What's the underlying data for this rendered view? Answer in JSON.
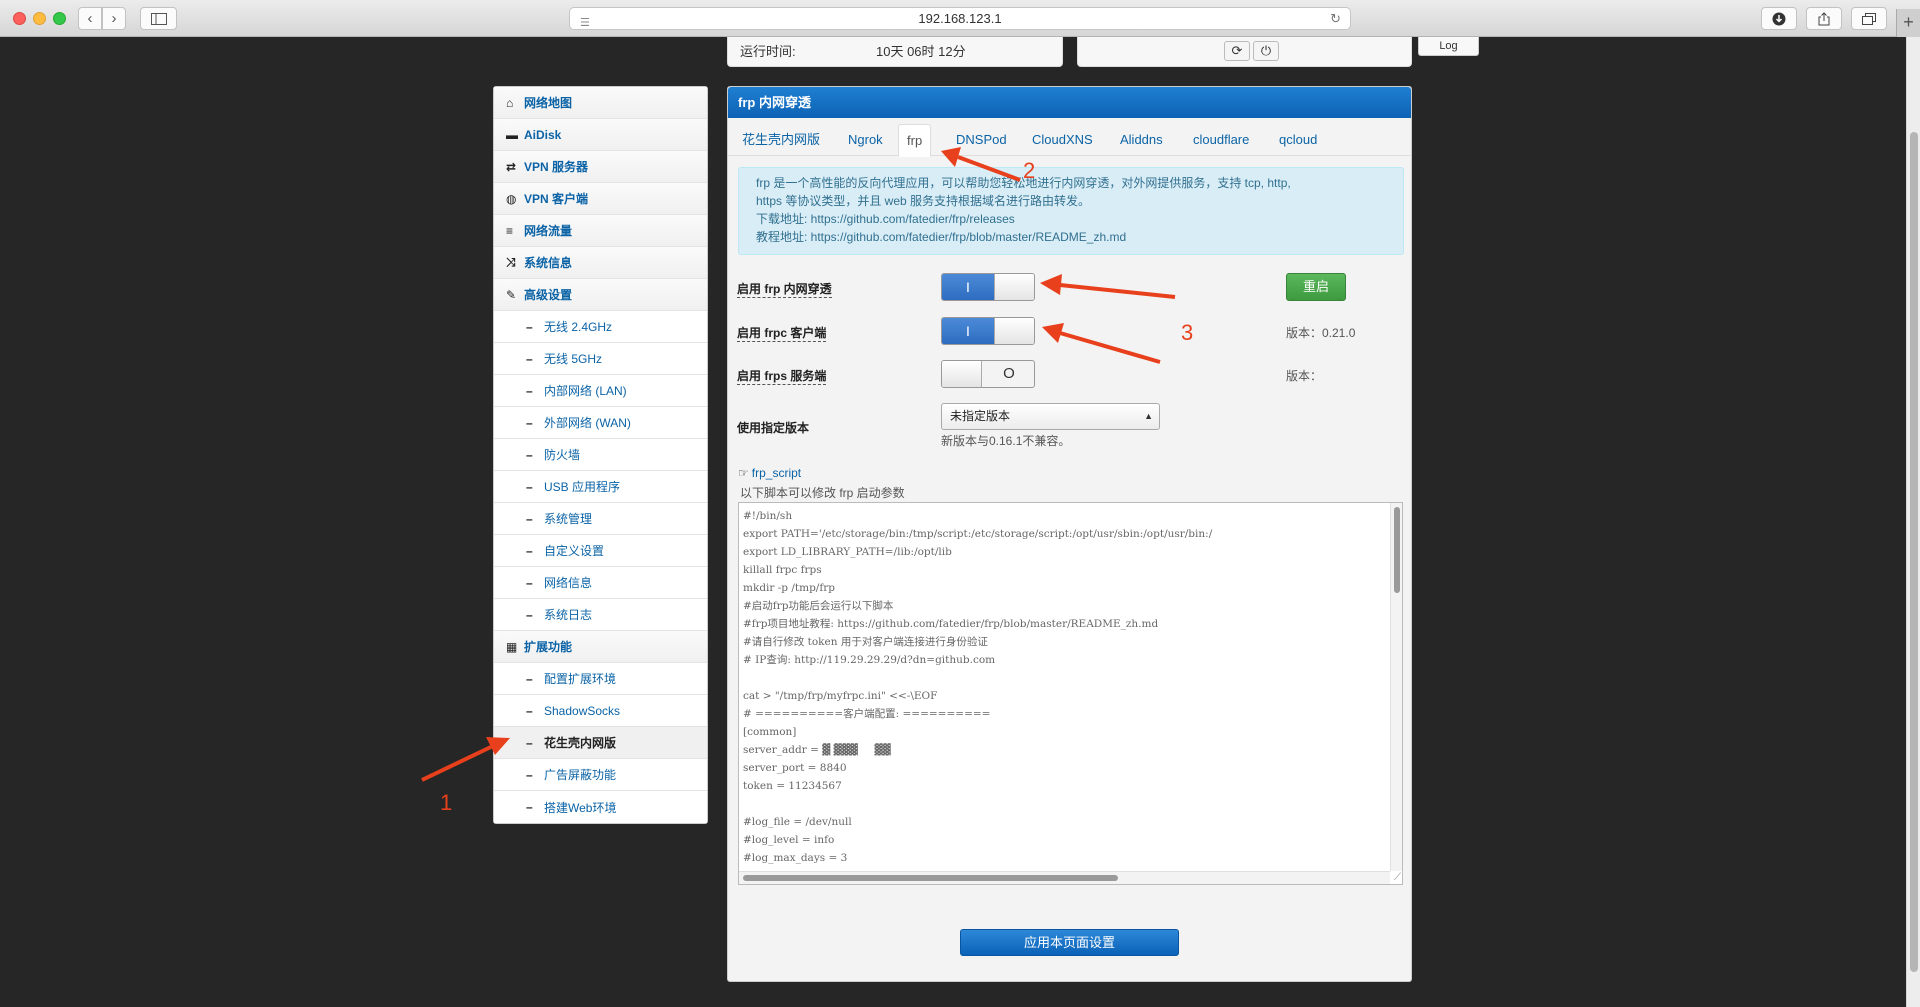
{
  "browser": {
    "url": "192.168.123.1",
    "nav_back_icon": "chevron-left-icon",
    "nav_forward_icon": "chevron-right-icon"
  },
  "status": {
    "uptime_label": "运行时间:",
    "uptime_value": "10天 06时 12分",
    "log_label": "Log"
  },
  "sidebar": {
    "items": [
      {
        "label": "网络地图",
        "icon": "home-icon",
        "level": "top"
      },
      {
        "label": "AiDisk",
        "icon": "drive-icon",
        "level": "top"
      },
      {
        "label": "VPN 服务器",
        "icon": "retweet-icon",
        "level": "top"
      },
      {
        "label": "VPN 客户端",
        "icon": "globe-icon",
        "level": "top"
      },
      {
        "label": "网络流量",
        "icon": "list-icon",
        "level": "top"
      },
      {
        "label": "系统信息",
        "icon": "random-icon",
        "level": "top"
      },
      {
        "label": "高级设置",
        "icon": "wrench-icon",
        "level": "top"
      },
      {
        "label": "无线 2.4GHz",
        "level": "sub"
      },
      {
        "label": "无线 5GHz",
        "level": "sub"
      },
      {
        "label": "内部网络 (LAN)",
        "level": "sub"
      },
      {
        "label": "外部网络 (WAN)",
        "level": "sub"
      },
      {
        "label": "防火墙",
        "level": "sub"
      },
      {
        "label": "USB 应用程序",
        "level": "sub"
      },
      {
        "label": "系统管理",
        "level": "sub"
      },
      {
        "label": "自定义设置",
        "level": "sub"
      },
      {
        "label": "网络信息",
        "level": "sub"
      },
      {
        "label": "系统日志",
        "level": "sub"
      },
      {
        "label": "扩展功能",
        "icon": "grid-icon",
        "level": "top"
      },
      {
        "label": "配置扩展环境",
        "level": "sub"
      },
      {
        "label": "ShadowSocks",
        "level": "sub"
      },
      {
        "label": "花生壳内网版",
        "level": "sub",
        "active": true
      },
      {
        "label": "广告屏蔽功能",
        "level": "sub"
      },
      {
        "label": "搭建Web环境",
        "level": "sub"
      }
    ]
  },
  "main": {
    "title": "frp 内网穿透",
    "tabs": [
      {
        "label": "花生壳内网版"
      },
      {
        "label": "Ngrok"
      },
      {
        "label": "frp",
        "active": true
      },
      {
        "label": "DNSPod"
      },
      {
        "label": "CloudXNS"
      },
      {
        "label": "Aliddns"
      },
      {
        "label": "cloudflare"
      },
      {
        "label": "qcloud"
      }
    ],
    "info": {
      "line1": "frp 是一个高性能的反向代理应用，可以帮助您轻松地进行内网穿透，对外网提供服务，支持 tcp, http,",
      "line2": "https 等协议类型，并且 web 服务支持根据域名进行路由转发。",
      "line3": "下载地址: https://github.com/fatedier/frp/releases",
      "line4": "教程地址: https://github.com/fatedier/frp/blob/master/README_zh.md"
    },
    "enable_frp": {
      "label": "启用 frp 内网穿透",
      "state": "on",
      "on_text": "I"
    },
    "enable_frpc": {
      "label": "启用 frpc 客户端",
      "state": "on",
      "on_text": "I"
    },
    "enable_frps": {
      "label": "启用 frps 服务端",
      "state": "off",
      "off_text": "O"
    },
    "restart_label": "重启",
    "frpc_version": "版本：0.21.0",
    "frps_version": "版本：",
    "version_select": {
      "label": "使用指定版本",
      "value": "未指定版本",
      "hint": "新版本与0.16.1不兼容。"
    },
    "script": {
      "link_label": "frp_script",
      "hint": "以下脚本可以修改 frp 启动参数",
      "lines": [
        "#!/bin/sh",
        "export PATH='/etc/storage/bin:/tmp/script:/etc/storage/script:/opt/usr/sbin:/opt/usr/bin:/",
        "export LD_LIBRARY_PATH=/lib:/opt/lib",
        "killall frpc frps",
        "mkdir -p /tmp/frp",
        "#启动frp功能后会运行以下脚本",
        "#frp项目地址教程: https://github.com/fatedier/frp/blob/master/README_zh.md",
        "#请自行修改 token 用于对客户端连接进行身份验证",
        "# IP查询: http://119.29.29.29/d?dn=github.com",
        "",
        "cat > \"/tmp/frp/myfrpc.ini\" <<-\\EOF",
        "# ==========客户端配置: ==========",
        "[common]",
        "server_addr = ▓ ▓▓▓     ▓▓",
        "server_port = 8840",
        "token = 11234567",
        "",
        "#log_file = /dev/null",
        "#log_level = info",
        "#log_max_days = 3"
      ]
    },
    "apply_label": "应用本页面设置"
  },
  "annotations": [
    {
      "number": "1"
    },
    {
      "number": "2"
    },
    {
      "number": "3"
    }
  ],
  "colors": {
    "accent_blue": "#0d62b5",
    "link_blue": "#0b63a6",
    "info_bg": "#d9edf7",
    "green": "#5cb85c",
    "annotation_red": "#e8401c",
    "page_bg": "#262626"
  }
}
